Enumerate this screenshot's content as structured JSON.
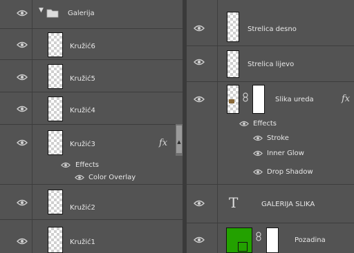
{
  "left_panel": {
    "group": {
      "name": "Galerija"
    },
    "layers": [
      {
        "name": "Kružić6"
      },
      {
        "name": "Kružić5"
      },
      {
        "name": "Kružić4"
      },
      {
        "name": "Kružić3",
        "fx": "fx",
        "effects_label": "Effects",
        "effects": [
          "Color Overlay"
        ]
      },
      {
        "name": "Kružić2"
      },
      {
        "name": "Kružić1"
      }
    ]
  },
  "right_panel": {
    "layers": [
      {
        "name": "Strelica desno"
      },
      {
        "name": "Strelica lijevo"
      },
      {
        "name": "Slika ureda",
        "fx": "fx",
        "effects_label": "Effects",
        "effects": [
          "Stroke",
          "Inner Glow",
          "Drop Shadow"
        ]
      },
      {
        "name": "GALERIJA SLIKA",
        "type_glyph": "T"
      },
      {
        "name": "Pozadina",
        "thumb_color": "#23a100"
      }
    ]
  },
  "icons": {
    "visibility": "eye-icon",
    "folder": "folder-icon",
    "disclosure": "triangle-down-icon",
    "link": "chain-link-icon"
  }
}
